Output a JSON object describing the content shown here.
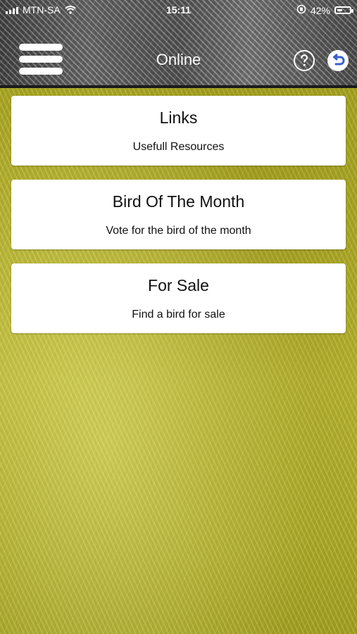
{
  "status_bar": {
    "carrier": "MTN-SA",
    "time": "15:11",
    "battery_percent": "42%",
    "battery_level": 0.42
  },
  "header": {
    "title": "Online",
    "menu_icon": "hamburger-menu-icon",
    "help_icon": "help-circle-icon",
    "back_icon": "back-arrow-icon"
  },
  "cards": [
    {
      "title": "Links",
      "subtitle": "Usefull Resources"
    },
    {
      "title": "Bird Of The Month",
      "subtitle": "Vote for the bird of the month"
    },
    {
      "title": "For Sale",
      "subtitle": "Find a bird for sale"
    }
  ],
  "colors": {
    "background": "#b7b52a",
    "card": "#ffffff",
    "accent": "#3b5fd1"
  }
}
